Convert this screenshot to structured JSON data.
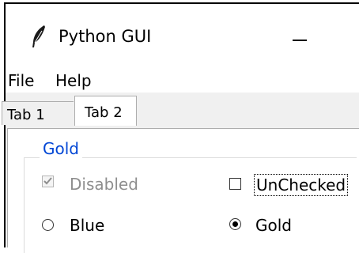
{
  "window": {
    "title": "Python GUI",
    "minimize_symbol": "—"
  },
  "menu": {
    "items": [
      "File",
      "Help"
    ]
  },
  "tabs": [
    {
      "label": "Tab 1",
      "selected": false
    },
    {
      "label": "Tab 2",
      "selected": true
    }
  ],
  "group": {
    "title": "Gold",
    "title_color": "#0046d5",
    "checkboxes": [
      {
        "label": "Disabled",
        "checked": true,
        "enabled": false
      },
      {
        "label": "UnChecked",
        "checked": false,
        "enabled": true,
        "focused": true
      }
    ],
    "radios": [
      {
        "label": "Blue",
        "selected": false
      },
      {
        "label": "Gold",
        "selected": true
      }
    ]
  },
  "icons": {
    "app": "feather-icon"
  }
}
